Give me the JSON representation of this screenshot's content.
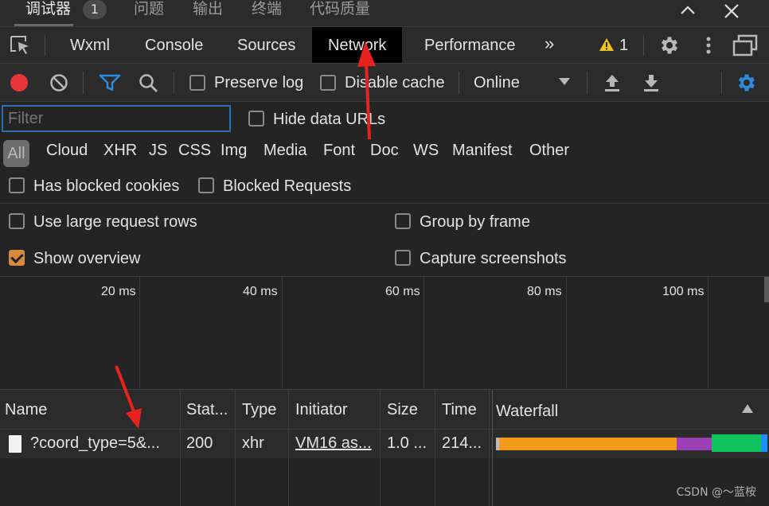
{
  "top_tabs": {
    "debugger": "调试器",
    "debugger_badge": "1",
    "issues": "问题",
    "output": "输出",
    "terminal": "终端",
    "code_quality": "代码质量"
  },
  "panel_tabs": [
    "Wxml",
    "Console",
    "Sources",
    "Network",
    "Performance"
  ],
  "panel_tabs_active": "Network",
  "more_tabs_glyph": "»",
  "warning_count": "1",
  "toolbar": {
    "preserve_log": "Preserve log",
    "disable_cache": "Disable cache",
    "throttling": "Online"
  },
  "filter": {
    "placeholder": "Filter",
    "hide_data_urls": "Hide data URLs"
  },
  "resource_types": [
    "All",
    "Cloud",
    "XHR",
    "JS",
    "CSS",
    "Img",
    "Media",
    "Font",
    "Doc",
    "WS",
    "Manifest",
    "Other"
  ],
  "resource_types_active": "All",
  "options": {
    "has_blocked_cookies": "Has blocked cookies",
    "blocked_requests": "Blocked Requests",
    "use_large_request_rows": "Use large request rows",
    "group_by_frame": "Group by frame",
    "show_overview": "Show overview",
    "capture_screenshots": "Capture screenshots",
    "show_overview_checked": true
  },
  "overview_ticks": [
    "20 ms",
    "40 ms",
    "60 ms",
    "80 ms",
    "100 ms"
  ],
  "table": {
    "headers": [
      "Name",
      "Stat...",
      "Type",
      "Initiator",
      "Size",
      "Time",
      "Waterfall"
    ],
    "rows": [
      {
        "name": "?coord_type=5&...",
        "status": "200",
        "type": "xhr",
        "initiator": "VM16 as...",
        "size": "1.0 ...",
        "time": "214..."
      }
    ]
  },
  "colors": {
    "accent_blue": "#2b8cde",
    "record_red": "#e8353a",
    "checkbox_orange": "#d9893c",
    "warning_yellow": "#f2c21b",
    "annotation_arrow": "#e8231f",
    "waterfall_queue": "#f39b1a",
    "waterfall_ttfb": "#9b3fb5",
    "waterfall_download": "#11c35c",
    "waterfall_end": "#1e90ff"
  },
  "watermark": "CSDN @～蓝桉"
}
